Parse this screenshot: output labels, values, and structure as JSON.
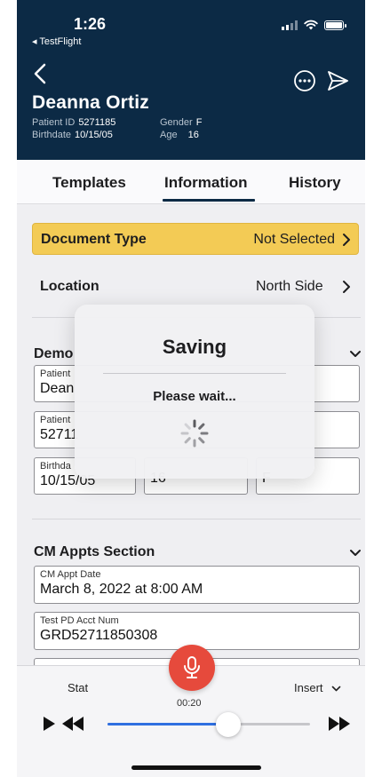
{
  "status_bar": {
    "time": "1:26",
    "back_app": "◂ TestFlight"
  },
  "patient": {
    "name": "Deanna Ortiz",
    "patient_id_label": "Patient ID",
    "patient_id": "5271185",
    "gender_label": "Gender",
    "gender": "F",
    "birthdate_label": "Birthdate",
    "birthdate": "10/15/05",
    "age_label": "Age",
    "age": "16"
  },
  "tabs": [
    {
      "label": "Templates",
      "active": false
    },
    {
      "label": "Information",
      "active": true
    },
    {
      "label": "History",
      "active": false
    }
  ],
  "document_type": {
    "label": "Document Type",
    "value": "Not Selected",
    "highlight_color": "#f3cb55"
  },
  "location": {
    "label": "Location",
    "value": "North Side"
  },
  "demographics": {
    "title": "Demo",
    "fields": [
      {
        "label": "Patient",
        "value": "Dean"
      },
      {
        "label": "Patient",
        "value": "52711"
      },
      {
        "label": "Birthda",
        "value": "10/15/05"
      },
      {
        "label": "",
        "value": "16"
      },
      {
        "label": "",
        "value": "F"
      }
    ]
  },
  "cm_appts": {
    "title": "CM Appts Section",
    "fields": [
      {
        "label": "CM Appt Date",
        "value": "March 8, 2022 at 8:00 AM"
      },
      {
        "label": "Test PD Acct Num",
        "value": "GRD52711850308"
      }
    ]
  },
  "modal": {
    "title": "Saving",
    "message": "Please wait..."
  },
  "player": {
    "stat_label": "Stat",
    "insert_label": "Insert",
    "timer": "00:20",
    "progress": 0.62,
    "accent": "#2f6fe0",
    "record_color": "#e64a3c"
  },
  "colors": {
    "header_bg": "#0c2a45"
  }
}
